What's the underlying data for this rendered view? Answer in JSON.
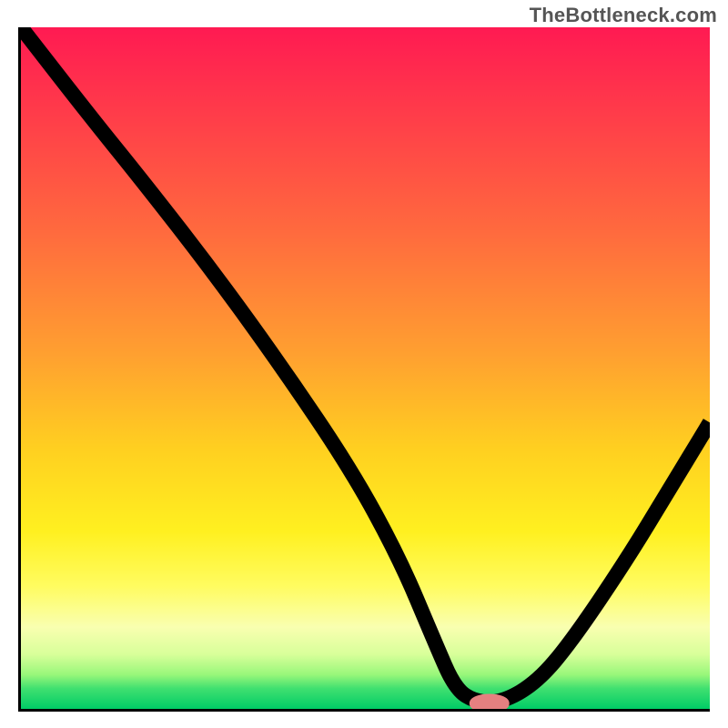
{
  "watermark": {
    "text": "TheBottleneck.com"
  },
  "chart_data": {
    "type": "line",
    "title": "",
    "xlabel": "",
    "ylabel": "",
    "xlim": [
      0,
      100
    ],
    "ylim": [
      0,
      100
    ],
    "series": [
      {
        "name": "bottleneck-curve",
        "x": [
          0,
          10,
          18,
          28,
          38,
          48,
          55,
          60,
          63,
          66,
          70,
          75,
          80,
          88,
          94,
          100
        ],
        "y": [
          100,
          87,
          77,
          64,
          50,
          35,
          22,
          10,
          3,
          1,
          1,
          4,
          10,
          22,
          32,
          42
        ]
      }
    ],
    "marker": {
      "name": "optimal-point",
      "x": 68,
      "y": 0.8,
      "rx": 2.4,
      "ry": 0.9
    },
    "background_gradient": {
      "stops": [
        {
          "pos": 0.0,
          "color": "#ff1a52"
        },
        {
          "pos": 0.3,
          "color": "#ff6a3e"
        },
        {
          "pos": 0.62,
          "color": "#ffd020"
        },
        {
          "pos": 0.88,
          "color": "#f9ffb0"
        },
        {
          "pos": 1.0,
          "color": "#00cc66"
        }
      ]
    }
  }
}
